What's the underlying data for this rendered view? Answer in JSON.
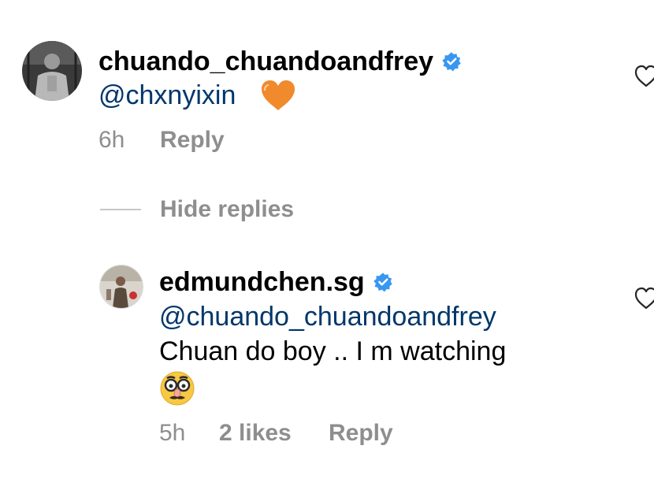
{
  "comment": {
    "username": "chuando_chuandoandfrey",
    "mention": "@chxnyixin",
    "heart_emoji": "orange-heart",
    "time": "6h",
    "reply_label": "Reply",
    "verified": true
  },
  "hide_replies_label": "Hide replies",
  "reply": {
    "username": "edmundchen.sg",
    "mention": "@chuando_chuandoandfrey",
    "text": "Chuan do boy .. I m watching",
    "emoji": "disguised-face",
    "time": "5h",
    "likes": "2 likes",
    "reply_label": "Reply",
    "verified": true
  },
  "colors": {
    "mention": "#00376b",
    "meta": "#8e8e8e",
    "verified": "#3897f0",
    "orange_heart": "#f08a2c"
  }
}
